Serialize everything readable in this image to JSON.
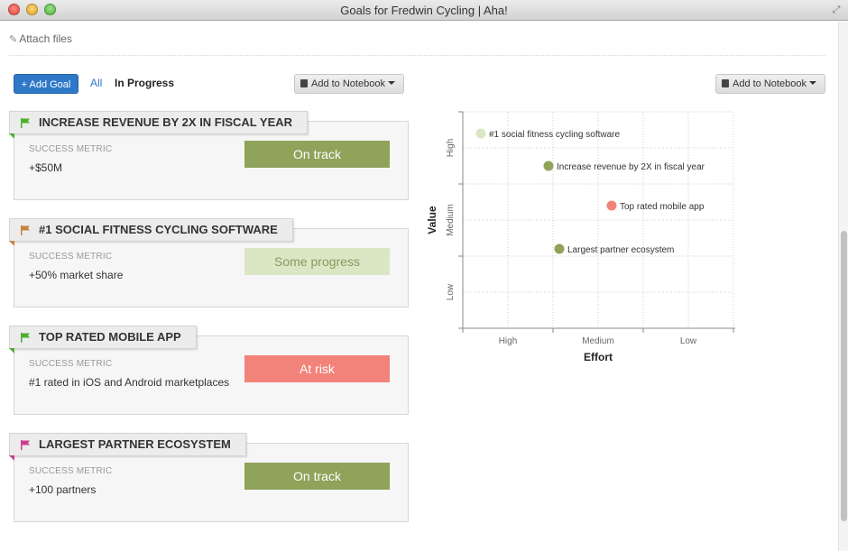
{
  "window": {
    "title": "Goals for Fredwin Cycling | Aha!"
  },
  "toolbar": {
    "attach_label": "Attach files",
    "add_goal_label": "+ Add Goal",
    "filter_all": "All",
    "filter_in_progress": "In Progress",
    "add_to_notebook_left": "Add to Notebook",
    "add_to_notebook_right": "Add to Notebook"
  },
  "colors": {
    "on_track": "#8fa35a",
    "some_progress": "#dbe6c4",
    "at_risk": "#f2837a",
    "link": "#2f78c7"
  },
  "goals": [
    {
      "title": "INCREASE REVENUE BY 2X IN FISCAL YEAR",
      "flag_color": "#4caf2f",
      "metric_label": "SUCCESS METRIC",
      "metric_value": "+$50M",
      "status": "On track",
      "status_color": "#8fa35a",
      "status_text_color": "#ffffff"
    },
    {
      "title": "#1 SOCIAL FITNESS CYCLING SOFTWARE",
      "flag_color": "#c8823c",
      "metric_label": "SUCCESS METRIC",
      "metric_value": "+50% market share",
      "status": "Some progress",
      "status_color": "#dbe6c4",
      "status_text_color": "#8a9a5e"
    },
    {
      "title": "TOP RATED MOBILE APP",
      "flag_color": "#4caf2f",
      "metric_label": "SUCCESS METRIC",
      "metric_value": "#1 rated in iOS and Android marketplaces",
      "status": "At risk",
      "status_color": "#f2837a",
      "status_text_color": "#ffffff"
    },
    {
      "title": "LARGEST PARTNER ECOSYSTEM",
      "flag_color": "#c93f8a",
      "metric_label": "SUCCESS METRIC",
      "metric_value": "+100 partners",
      "status": "On track",
      "status_color": "#8fa35a",
      "status_text_color": "#ffffff"
    }
  ],
  "chart_data": {
    "type": "scatter",
    "xlabel": "Effort",
    "ylabel": "Value",
    "x_ticks": [
      "High",
      "Medium",
      "Low"
    ],
    "y_ticks": [
      "High",
      "Medium",
      "Low"
    ],
    "xlim": [
      0,
      3
    ],
    "ylim": [
      0,
      3
    ],
    "grid": true,
    "points": [
      {
        "label": "#1 social fitness cycling software",
        "x": 0.2,
        "y": 2.7,
        "color": "#dbe6c4"
      },
      {
        "label": "Increase revenue by 2X in fiscal year",
        "x": 0.95,
        "y": 2.25,
        "color": "#8fa35a"
      },
      {
        "label": "Top rated mobile app",
        "x": 1.65,
        "y": 1.7,
        "color": "#f2837a"
      },
      {
        "label": "Largest partner ecosystem",
        "x": 1.07,
        "y": 1.1,
        "color": "#8fa35a"
      }
    ]
  }
}
